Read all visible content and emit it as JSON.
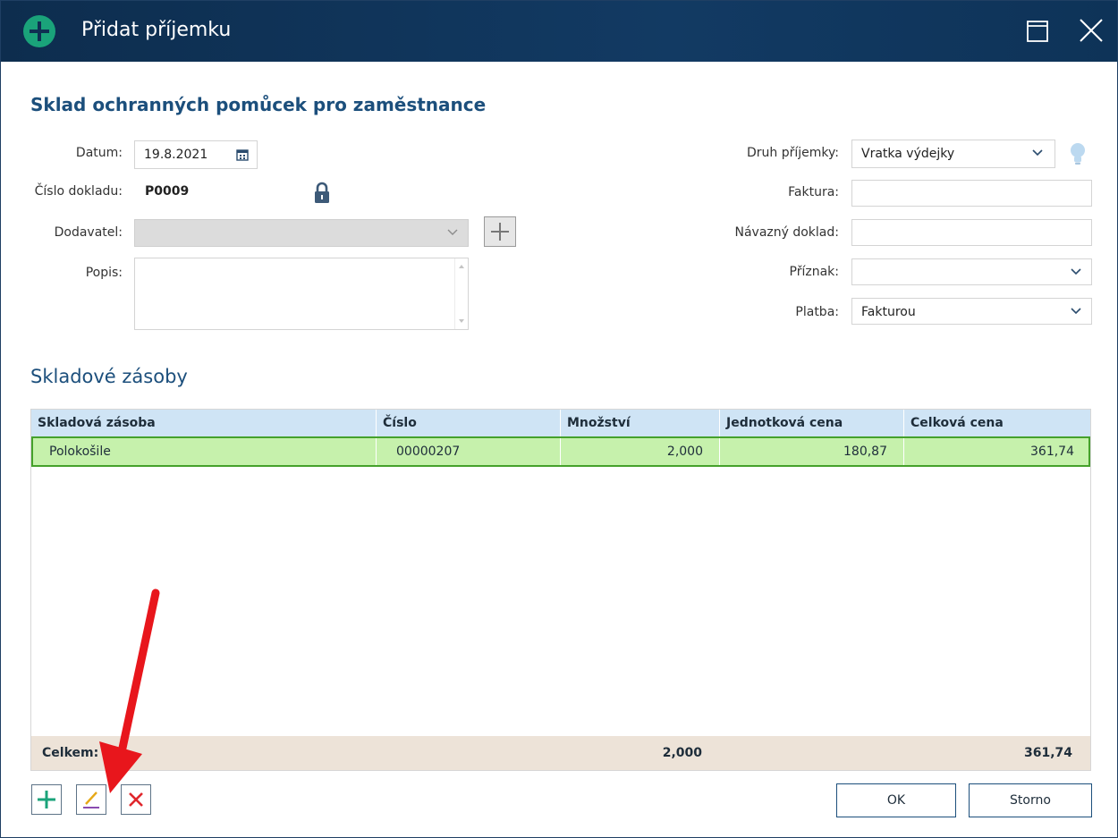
{
  "window": {
    "title": "Přidat příjemku"
  },
  "heading": "Sklad ochranných pomůcek pro zaměstnance",
  "form": {
    "datum_label": "Datum:",
    "datum_value": "19.8.2021",
    "cislo_label": "Číslo dokladu:",
    "cislo_value": "P0009",
    "dodavatel_label": "Dodavatel:",
    "dodavatel_value": "",
    "popis_label": "Popis:",
    "popis_value": "",
    "druh_label": "Druh příjemky:",
    "druh_value": "Vratka výdejky",
    "faktura_label": "Faktura:",
    "faktura_value": "",
    "navazny_label": "Návazný doklad:",
    "navazny_value": "",
    "priznak_label": "Příznak:",
    "priznak_value": "",
    "platba_label": "Platba:",
    "platba_value": "Fakturou"
  },
  "stock": {
    "title": "Skladové zásoby",
    "columns": [
      "Skladová zásoba",
      "Číslo",
      "Množství",
      "Jednotková cena",
      "Celková cena"
    ],
    "rows": [
      {
        "name": "Polokošile",
        "number": "00000207",
        "quantity": "2,000",
        "unit_price": "180,87",
        "total_price": "361,74"
      }
    ],
    "footer": {
      "label": "Celkem:",
      "quantity": "2,000",
      "total_price": "361,74"
    }
  },
  "buttons": {
    "ok": "OK",
    "cancel": "Storno"
  },
  "colors": {
    "titlebar": "#123a63",
    "accent_green": "#1aa37a",
    "row_selected": "#c6f1ac",
    "annotation_arrow": "#e8161c"
  },
  "icons": {
    "title": "plus-circle-icon",
    "maximize": "maximize-icon",
    "close": "close-icon",
    "calendar": "calendar-icon",
    "lock": "lock-icon",
    "hint": "lightbulb-icon",
    "add": "plus-icon",
    "edit": "pencil-icon",
    "delete": "x-icon"
  }
}
